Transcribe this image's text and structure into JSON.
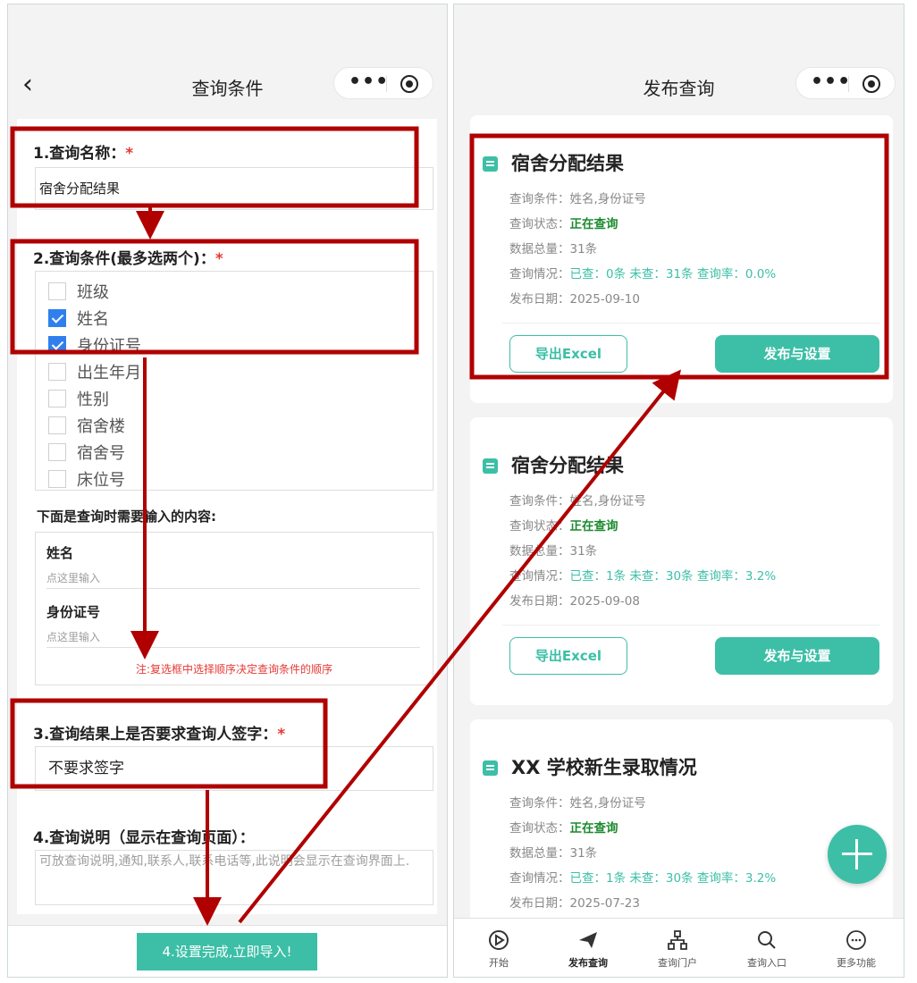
{
  "left_screen": {
    "title": "查询条件",
    "back_icon": "chevron-left-icon",
    "q1_label": "1.查询名称：",
    "q1_value": "宿舍分配结果",
    "q2_label": "2.查询条件(最多选两个)：",
    "options": [
      {
        "label": "班级",
        "checked": false
      },
      {
        "label": "姓名",
        "checked": true
      },
      {
        "label": "身份证号",
        "checked": true
      },
      {
        "label": "出生年月",
        "checked": false
      },
      {
        "label": "性别",
        "checked": false
      },
      {
        "label": "宿舍楼",
        "checked": false
      },
      {
        "label": "宿舍号",
        "checked": false
      },
      {
        "label": "床位号",
        "checked": false
      }
    ],
    "inputs_heading": "下面是查询时需要输入的内容:",
    "input_fields": [
      {
        "name": "姓名",
        "placeholder": "点这里输入"
      },
      {
        "name": "身份证号",
        "placeholder": "点这里输入"
      }
    ],
    "order_note": "注:复选框中选择顺序决定查询条件的顺序",
    "q3_label": "3.查询结果上是否要求查询人签字：",
    "q3_value": "不要求签字",
    "q4_label": "4.查询说明（显示在查询页面）：",
    "q4_placeholder": "可放查询说明,通知,联系人,联系电话等,此说明会显示在查询界面上.",
    "submit_label": "4.设置完成,立即导入!",
    "required_mark": "*"
  },
  "right_screen": {
    "title": "发布查询",
    "cards": [
      {
        "title": "宿舍分配结果",
        "cond_label": "查询条件：",
        "cond": "姓名,身份证号",
        "status_label": "查询状态：",
        "status": "正在查询",
        "total_label": "数据总量：",
        "total": "31条",
        "progress_label": "查询情况：",
        "progress": "已查：0条 未查：31条 查询率：0.0%",
        "date_label": "发布日期：",
        "date": "2025-09-10",
        "export": "导出Excel",
        "publish": "发布与设置"
      },
      {
        "title": "宿舍分配结果",
        "cond_label": "查询条件：",
        "cond": "姓名,身份证号",
        "status_label": "查询状态：",
        "status": "正在查询",
        "total_label": "数据总量：",
        "total": "31条",
        "progress_label": "查询情况：",
        "progress": "已查：1条 未查：30条 查询率：3.2%",
        "date_label": "发布日期：",
        "date": "2025-09-08",
        "export": "导出Excel",
        "publish": "发布与设置"
      },
      {
        "title": "XX 学校新生录取情况",
        "cond_label": "查询条件：",
        "cond": "姓名,身份证号",
        "status_label": "查询状态：",
        "status": "正在查询",
        "total_label": "数据总量：",
        "total": "31条",
        "progress_label": "查询情况：",
        "progress": "已查：1条 未查：30条 查询率：3.2%",
        "date_label": "发布日期：",
        "date": "2025-07-23"
      }
    ],
    "tabs": [
      {
        "label": "开始",
        "icon": "play-circle-icon"
      },
      {
        "label": "发布查询",
        "icon": "send-icon",
        "active": true
      },
      {
        "label": "查询门户",
        "icon": "sitemap-icon"
      },
      {
        "label": "查询入口",
        "icon": "search-icon"
      },
      {
        "label": "更多功能",
        "icon": "more-circle-icon"
      }
    ],
    "fab_icon": "plus-icon"
  },
  "capsule": {
    "more_icon": "more-dots-icon",
    "close_icon": "target-icon",
    "dots": "•••"
  },
  "colors": {
    "accent": "#3cbfa6",
    "annotation": "#b00000",
    "status": "#1b8a2e",
    "checkbox": "#2f80ed"
  }
}
